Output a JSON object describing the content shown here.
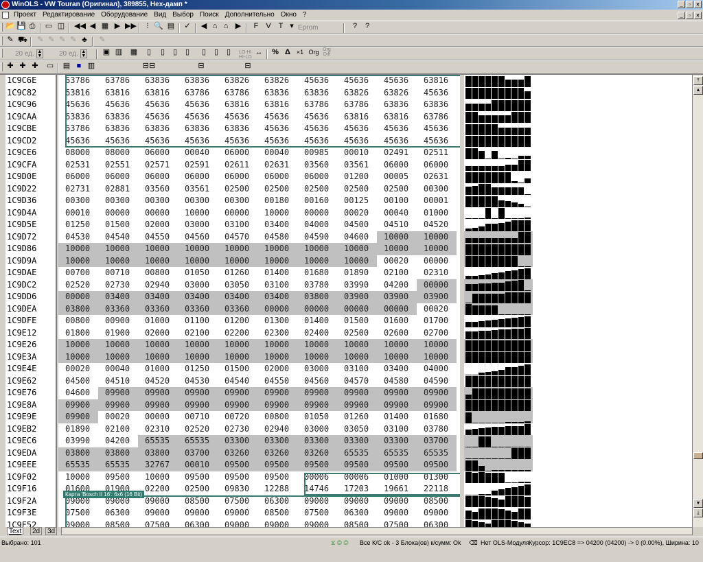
{
  "window": {
    "title": "WinOLS - VW Touran (Оригинал), 389855, Hex-дамп *",
    "min_glyph": "_",
    "max_glyph": "▫",
    "close_glyph": "×"
  },
  "menu": {
    "items": [
      "Проект",
      "Редактирование",
      "Оборудование",
      "Вид",
      "Выбор",
      "Поиск",
      "Дополнительно",
      "Окно",
      "?"
    ]
  },
  "toolbar": {
    "eprom_label": "Eprom",
    "spin1_label": "20 ед.",
    "spin2_label": "20 ед.",
    "ascii_labels": [
      "LO-HI",
      "HI-LO"
    ],
    "percent_label": "%",
    "delta_label": "Δ",
    "times1_label": "×1",
    "org_label": "Org",
    "org_diff_label": "Org Diff",
    "icons": [
      "open-icon",
      "save-icon",
      "print-icon",
      "folder-icon",
      "compare-icon",
      "first-icon",
      "prev-icon",
      "table-icon",
      "next-icon",
      "last-icon",
      "find-icon",
      "hex-icon",
      "map-icon",
      "checksum-icon",
      "help-icon",
      "context-help-icon"
    ]
  },
  "addresses": [
    "1C9C6E",
    "1C9C82",
    "1C9C96",
    "1C9CAA",
    "1C9CBE",
    "1C9CD2",
    "1C9CE6",
    "1C9CFA",
    "1C9D0E",
    "1C9D22",
    "1C9D36",
    "1C9D4A",
    "1C9D5E",
    "1C9D72",
    "1C9D86",
    "1C9D9A",
    "1C9DAE",
    "1C9DC2",
    "1C9DD6",
    "1C9DEA",
    "1C9DFE",
    "1C9E12",
    "1C9E26",
    "1C9E3A",
    "1C9E4E",
    "1C9E62",
    "1C9E76",
    "1C9E8A",
    "1C9E9E",
    "1C9EB2",
    "1C9EC6",
    "1C9EDA",
    "1C9EEE",
    "1C9F02",
    "1C9F16",
    "1C9F2A",
    "1C9F3E",
    "1C9F52"
  ],
  "rows": [
    [
      "63786",
      "63786",
      "63836",
      "63836",
      "63826",
      "63826",
      "45636",
      "45636",
      "45636",
      "63816"
    ],
    [
      "63816",
      "63816",
      "63816",
      "63786",
      "63786",
      "63836",
      "63836",
      "63826",
      "63826",
      "45636"
    ],
    [
      "45636",
      "45636",
      "45636",
      "45636",
      "63816",
      "63816",
      "63786",
      "63786",
      "63836",
      "63836"
    ],
    [
      "63836",
      "63836",
      "45636",
      "45636",
      "45636",
      "45636",
      "45636",
      "63816",
      "63816",
      "63786"
    ],
    [
      "63786",
      "63836",
      "63836",
      "63836",
      "63836",
      "45636",
      "45636",
      "45636",
      "45636",
      "45636"
    ],
    [
      "45636",
      "45636",
      "45636",
      "45636",
      "45636",
      "45636",
      "45636",
      "45636",
      "45636",
      "45636"
    ],
    [
      "08000",
      "08000",
      "06000",
      "00040",
      "06000",
      "00040",
      "00985",
      "00010",
      "02491",
      "02511"
    ],
    [
      "02531",
      "02551",
      "02571",
      "02591",
      "02611",
      "02631",
      "03560",
      "03561",
      "06000",
      "06000"
    ],
    [
      "06000",
      "06000",
      "06000",
      "06000",
      "06000",
      "06000",
      "06000",
      "01200",
      "00005",
      "02631"
    ],
    [
      "02731",
      "02881",
      "03560",
      "03561",
      "02500",
      "02500",
      "02500",
      "02500",
      "02500",
      "00300"
    ],
    [
      "00300",
      "00300",
      "00300",
      "00300",
      "00300",
      "00180",
      "00160",
      "00125",
      "00100",
      "00001"
    ],
    [
      "00010",
      "00000",
      "00000",
      "10000",
      "00000",
      "10000",
      "00000",
      "00020",
      "00040",
      "01000"
    ],
    [
      "01250",
      "01500",
      "02000",
      "03000",
      "03100",
      "03400",
      "04000",
      "04500",
      "04510",
      "04520"
    ],
    [
      "04530",
      "04540",
      "04550",
      "04560",
      "04570",
      "04580",
      "04590",
      "04600",
      "10000",
      "10000"
    ],
    [
      "10000",
      "10000",
      "10000",
      "10000",
      "10000",
      "10000",
      "10000",
      "10000",
      "10000",
      "10000"
    ],
    [
      "10000",
      "10000",
      "10000",
      "10000",
      "10000",
      "10000",
      "10000",
      "10000",
      "00020",
      "00000"
    ],
    [
      "00700",
      "00710",
      "00800",
      "01050",
      "01260",
      "01400",
      "01680",
      "01890",
      "02100",
      "02310"
    ],
    [
      "02520",
      "02730",
      "02940",
      "03000",
      "03050",
      "03100",
      "03780",
      "03990",
      "04200",
      "00000"
    ],
    [
      "00000",
      "03400",
      "03400",
      "03400",
      "03400",
      "03400",
      "03800",
      "03900",
      "03900",
      "03900"
    ],
    [
      "03800",
      "03360",
      "03360",
      "03360",
      "03360",
      "00000",
      "00000",
      "00000",
      "00000",
      "00020"
    ],
    [
      "00800",
      "00900",
      "01000",
      "01100",
      "01200",
      "01300",
      "01400",
      "01500",
      "01600",
      "01700"
    ],
    [
      "01800",
      "01900",
      "02000",
      "02100",
      "02200",
      "02300",
      "02400",
      "02500",
      "02600",
      "02700"
    ],
    [
      "10000",
      "10000",
      "10000",
      "10000",
      "10000",
      "10000",
      "10000",
      "10000",
      "10000",
      "10000"
    ],
    [
      "10000",
      "10000",
      "10000",
      "10000",
      "10000",
      "10000",
      "10000",
      "10000",
      "10000",
      "10000"
    ],
    [
      "00020",
      "00040",
      "01000",
      "01250",
      "01500",
      "02000",
      "03000",
      "03100",
      "03400",
      "04000"
    ],
    [
      "04500",
      "04510",
      "04520",
      "04530",
      "04540",
      "04550",
      "04560",
      "04570",
      "04580",
      "04590"
    ],
    [
      "04600",
      "09900",
      "09900",
      "09900",
      "09900",
      "09900",
      "09900",
      "09900",
      "09900",
      "09900"
    ],
    [
      "09900",
      "09900",
      "09900",
      "09900",
      "09900",
      "09900",
      "09900",
      "09900",
      "09900",
      "09900"
    ],
    [
      "09900",
      "00020",
      "00000",
      "00710",
      "00720",
      "00800",
      "01050",
      "01260",
      "01400",
      "01680"
    ],
    [
      "01890",
      "02100",
      "02310",
      "02520",
      "02730",
      "02940",
      "03000",
      "03050",
      "03100",
      "03780"
    ],
    [
      "03990",
      "04200",
      "65535",
      "65535",
      "03300",
      "03300",
      "03300",
      "03300",
      "03300",
      "03700"
    ],
    [
      "03800",
      "03800",
      "03800",
      "03700",
      "03260",
      "03260",
      "03260",
      "65535",
      "65535",
      "65535"
    ],
    [
      "65535",
      "65535",
      "32767",
      "00010",
      "09500",
      "09500",
      "09500",
      "09500",
      "09500",
      "09500"
    ],
    [
      "10000",
      "09500",
      "10000",
      "09500",
      "09500",
      "09500",
      "00006",
      "00006",
      "01000",
      "01300"
    ],
    [
      "01600",
      "01900",
      "02200",
      "02500",
      "09830",
      "12288",
      "14746",
      "17203",
      "19661",
      "22118"
    ],
    [
      "09000",
      "09000",
      "09000",
      "08500",
      "07500",
      "06300",
      "09000",
      "09000",
      "09000",
      "08500"
    ],
    [
      "07500",
      "06300",
      "09000",
      "09000",
      "09000",
      "08500",
      "07500",
      "06300",
      "09000",
      "09000"
    ],
    [
      "09000",
      "08500",
      "07500",
      "06300",
      "09000",
      "09000",
      "09000",
      "08500",
      "07500",
      "06300"
    ]
  ],
  "selected_cells": [
    [
      13,
      8
    ],
    [
      13,
      9
    ],
    [
      14,
      0
    ],
    [
      14,
      1
    ],
    [
      14,
      2
    ],
    [
      14,
      3
    ],
    [
      14,
      4
    ],
    [
      14,
      5
    ],
    [
      14,
      6
    ],
    [
      14,
      7
    ],
    [
      14,
      8
    ],
    [
      14,
      9
    ],
    [
      15,
      0
    ],
    [
      15,
      1
    ],
    [
      15,
      2
    ],
    [
      15,
      3
    ],
    [
      15,
      4
    ],
    [
      15,
      5
    ],
    [
      15,
      6
    ],
    [
      15,
      7
    ],
    [
      17,
      9
    ],
    [
      18,
      0
    ],
    [
      18,
      1
    ],
    [
      18,
      2
    ],
    [
      18,
      3
    ],
    [
      18,
      4
    ],
    [
      18,
      5
    ],
    [
      18,
      6
    ],
    [
      18,
      7
    ],
    [
      18,
      8
    ],
    [
      18,
      9
    ],
    [
      19,
      0
    ],
    [
      19,
      1
    ],
    [
      19,
      2
    ],
    [
      19,
      3
    ],
    [
      19,
      4
    ],
    [
      19,
      5
    ],
    [
      19,
      6
    ],
    [
      19,
      7
    ],
    [
      19,
      8
    ],
    [
      22,
      0
    ],
    [
      22,
      1
    ],
    [
      22,
      2
    ],
    [
      22,
      3
    ],
    [
      22,
      4
    ],
    [
      22,
      5
    ],
    [
      22,
      6
    ],
    [
      22,
      7
    ],
    [
      22,
      8
    ],
    [
      22,
      9
    ],
    [
      23,
      0
    ],
    [
      23,
      1
    ],
    [
      23,
      2
    ],
    [
      23,
      3
    ],
    [
      23,
      4
    ],
    [
      23,
      5
    ],
    [
      23,
      6
    ],
    [
      23,
      7
    ],
    [
      23,
      8
    ],
    [
      23,
      9
    ],
    [
      26,
      1
    ],
    [
      26,
      2
    ],
    [
      26,
      3
    ],
    [
      26,
      4
    ],
    [
      26,
      5
    ],
    [
      26,
      6
    ],
    [
      26,
      7
    ],
    [
      26,
      8
    ],
    [
      26,
      9
    ],
    [
      27,
      0
    ],
    [
      27,
      1
    ],
    [
      27,
      2
    ],
    [
      27,
      3
    ],
    [
      27,
      4
    ],
    [
      27,
      5
    ],
    [
      27,
      6
    ],
    [
      27,
      7
    ],
    [
      27,
      8
    ],
    [
      27,
      9
    ],
    [
      28,
      0
    ],
    [
      30,
      2
    ],
    [
      30,
      3
    ],
    [
      30,
      4
    ],
    [
      30,
      5
    ],
    [
      30,
      6
    ],
    [
      30,
      7
    ],
    [
      30,
      8
    ],
    [
      30,
      9
    ],
    [
      31,
      0
    ],
    [
      31,
      1
    ],
    [
      31,
      2
    ],
    [
      31,
      3
    ],
    [
      31,
      4
    ],
    [
      31,
      5
    ],
    [
      31,
      6
    ],
    [
      31,
      7
    ],
    [
      31,
      8
    ],
    [
      31,
      9
    ],
    [
      32,
      0
    ],
    [
      32,
      1
    ],
    [
      32,
      2
    ],
    [
      32,
      3
    ],
    [
      32,
      4
    ],
    [
      32,
      5
    ],
    [
      32,
      6
    ],
    [
      32,
      7
    ],
    [
      32,
      8
    ],
    [
      32,
      9
    ]
  ],
  "map_label": "Карта 'Bosch II 16': 6x6 (16 Bit)",
  "bottom_tabs": [
    "Text",
    "2d",
    "3d"
  ],
  "status": {
    "selected": "Выбрано: 101",
    "checksum": "Все К/С ok - 3 Блока(ов) к/сумм: Ok",
    "ols_module": "Нет OLS-Модуля",
    "cursor": "Курсор: 1C9EC8 => 04200 (04200) -> 0 (0.00%), Ширина: 10"
  }
}
